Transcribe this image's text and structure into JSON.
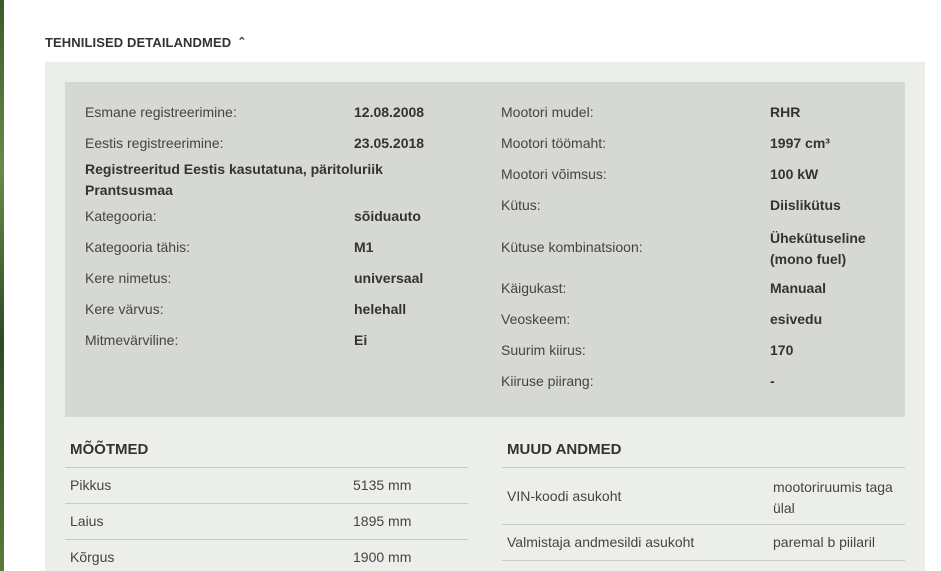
{
  "section": {
    "title": "TEHNILISED DETAILANDMED",
    "toggle_icon": "chevron-up-double"
  },
  "left_specs": [
    {
      "label": "Esmane registreerimine:",
      "value": "12.08.2008"
    },
    {
      "label": "Eestis registreerimine:",
      "value": "23.05.2018"
    },
    {
      "label": "Kategooria:",
      "value": "sõiduauto"
    },
    {
      "label": "Kategooria tähis:",
      "value": "M1"
    },
    {
      "label": "Kere nimetus:",
      "value": "universaal"
    },
    {
      "label": "Kere värvus:",
      "value": "helehall"
    },
    {
      "label": "Mitmevärviline:",
      "value": "Ei"
    }
  ],
  "registration_note": "Registreeritud Eestis kasutatuna, päritoluriik Prantsusmaa",
  "right_specs": [
    {
      "label": "Mootori mudel:",
      "value": "RHR"
    },
    {
      "label": "Mootori töömaht:",
      "value": "1997 cm³"
    },
    {
      "label": "Mootori võimsus:",
      "value": "100 kW"
    },
    {
      "label": "Kütus:",
      "value": "Diislikütus"
    },
    {
      "label": "Kütuse kombinatsioon:",
      "value": "Ühekütuseline (mono fuel)"
    },
    {
      "label": "Käigukast:",
      "value": "Manuaal"
    },
    {
      "label": "Veoskeem:",
      "value": "esivedu"
    },
    {
      "label": "Suurim kiirus:",
      "value": "170"
    },
    {
      "label": "Kiiruse piirang:",
      "value": "-"
    }
  ],
  "dimensions": {
    "title": "MÕÕTMED",
    "rows": [
      {
        "label": "Pikkus",
        "value": "5135 mm"
      },
      {
        "label": "Laius",
        "value": "1895 mm"
      },
      {
        "label": "Kõrgus",
        "value": "1900 mm"
      }
    ]
  },
  "other": {
    "title": "MUUD ANDMED",
    "rows": [
      {
        "label": "VIN-koodi asukoht",
        "value": "mootoriruumis taga ülal"
      },
      {
        "label": "Valmistaja andmesildi asukoht",
        "value": "paremal b piilaril"
      }
    ]
  }
}
